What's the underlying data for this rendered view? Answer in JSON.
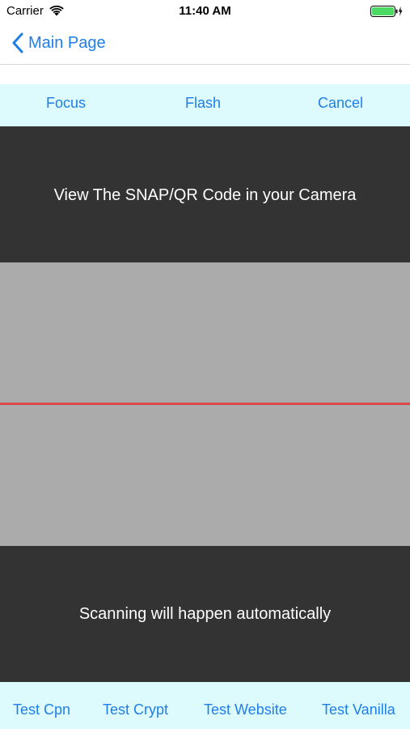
{
  "status_bar": {
    "carrier": "Carrier",
    "time": "11:40 AM",
    "wifi_icon": "wifi-icon",
    "battery_icon": "battery-charging-icon",
    "battery_color": "#4cd964"
  },
  "nav": {
    "back_label": "Main Page",
    "back_icon": "chevron-left-icon"
  },
  "controls": {
    "focus": "Focus",
    "flash": "Flash",
    "cancel": "Cancel"
  },
  "scanner": {
    "top_message": "View The SNAP/QR Code in your Camera",
    "bottom_message": "Scanning will happen automatically",
    "scan_line_color": "#d64a4a"
  },
  "tests": {
    "cpn": "Test Cpn",
    "crypt": "Test Crypt",
    "website": "Test Website",
    "vanilla": "Test Vanilla"
  },
  "colors": {
    "accent": "#1f7ee8",
    "toolbar_bg": "#ddfbfd",
    "dark_panel": "#333333",
    "camera_bg": "#ababab"
  }
}
